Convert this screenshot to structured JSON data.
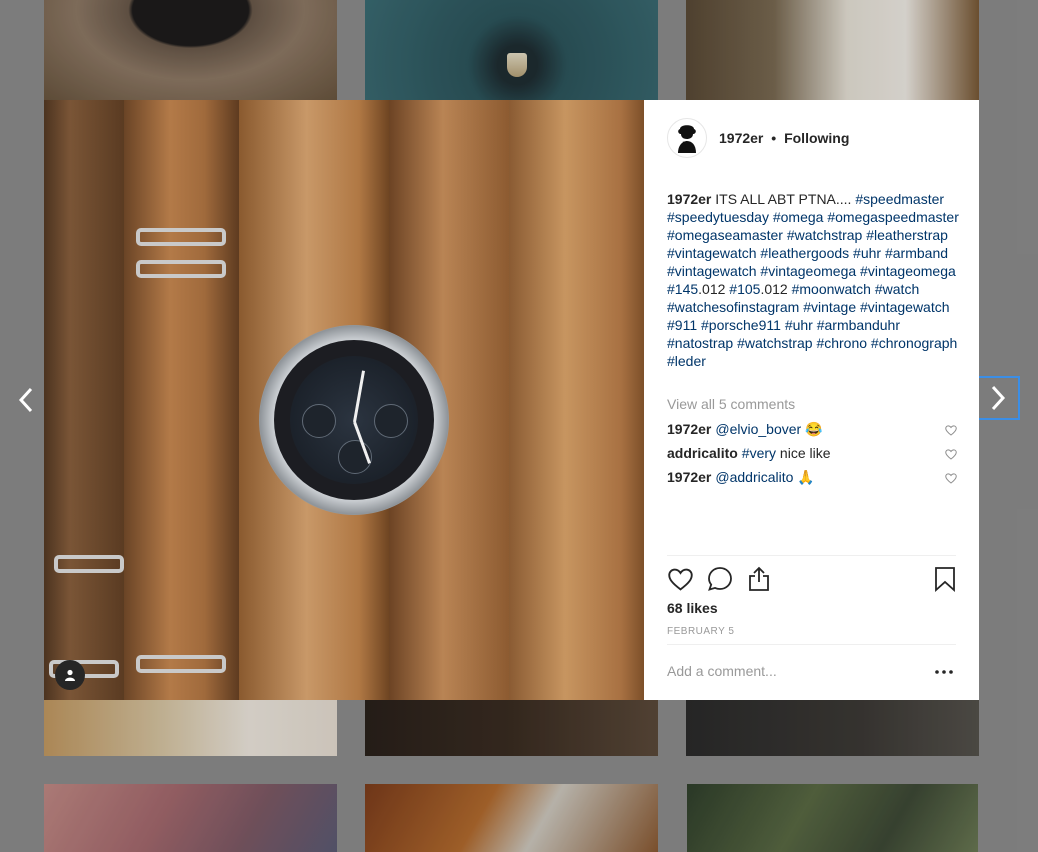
{
  "post": {
    "username": "1972er",
    "separator": "•",
    "follow_status": "Following",
    "caption": {
      "user": "1972er",
      "segments": [
        {
          "text": " ITS ALL ABT PTNA.... ",
          "tag": false
        },
        {
          "text": "#speedmaster",
          "tag": true
        },
        {
          "text": " ",
          "tag": false
        },
        {
          "text": "#speedytuesday",
          "tag": true
        },
        {
          "text": " ",
          "tag": false
        },
        {
          "text": "#omega",
          "tag": true
        },
        {
          "text": " ",
          "tag": false
        },
        {
          "text": "#omegaspeedmaster",
          "tag": true
        },
        {
          "text": " ",
          "tag": false
        },
        {
          "text": "#omegaseamaster",
          "tag": true
        },
        {
          "text": " ",
          "tag": false
        },
        {
          "text": "#watchstrap",
          "tag": true
        },
        {
          "text": " ",
          "tag": false
        },
        {
          "text": "#leatherstrap",
          "tag": true
        },
        {
          "text": " ",
          "tag": false
        },
        {
          "text": "#vintagewatch",
          "tag": true
        },
        {
          "text": " ",
          "tag": false
        },
        {
          "text": "#leathergoods",
          "tag": true
        },
        {
          "text": " ",
          "tag": false
        },
        {
          "text": "#uhr",
          "tag": true
        },
        {
          "text": " ",
          "tag": false
        },
        {
          "text": "#armband",
          "tag": true
        },
        {
          "text": " ",
          "tag": false
        },
        {
          "text": "#vintagewatch",
          "tag": true
        },
        {
          "text": " ",
          "tag": false
        },
        {
          "text": "#vintageomega",
          "tag": true
        },
        {
          "text": " ",
          "tag": false
        },
        {
          "text": "#vintageomega",
          "tag": true
        },
        {
          "text": " ",
          "tag": false
        },
        {
          "text": "#145",
          "tag": true
        },
        {
          "text": ".012 ",
          "tag": false
        },
        {
          "text": "#105",
          "tag": true
        },
        {
          "text": ".012 ",
          "tag": false
        },
        {
          "text": "#moonwatch",
          "tag": true
        },
        {
          "text": " ",
          "tag": false
        },
        {
          "text": "#watch",
          "tag": true
        },
        {
          "text": " ",
          "tag": false
        },
        {
          "text": "#watchesofinstagram",
          "tag": true
        },
        {
          "text": " ",
          "tag": false
        },
        {
          "text": "#vintage",
          "tag": true
        },
        {
          "text": " ",
          "tag": false
        },
        {
          "text": "#vintagewatch",
          "tag": true
        },
        {
          "text": " ",
          "tag": false
        },
        {
          "text": "#911",
          "tag": true
        },
        {
          "text": " ",
          "tag": false
        },
        {
          "text": "#porsche911",
          "tag": true
        },
        {
          "text": " ",
          "tag": false
        },
        {
          "text": "#uhr",
          "tag": true
        },
        {
          "text": " ",
          "tag": false
        },
        {
          "text": "#armbanduhr",
          "tag": true
        },
        {
          "text": " ",
          "tag": false
        },
        {
          "text": "#natostrap",
          "tag": true
        },
        {
          "text": " ",
          "tag": false
        },
        {
          "text": "#watchstrap",
          "tag": true
        },
        {
          "text": " ",
          "tag": false
        },
        {
          "text": "#chrono",
          "tag": true
        },
        {
          "text": " ",
          "tag": false
        },
        {
          "text": "#chronograph",
          "tag": true
        },
        {
          "text": " ",
          "tag": false
        },
        {
          "text": "#leder",
          "tag": true
        }
      ]
    },
    "view_all_comments": "View all 5 comments",
    "comments": [
      {
        "user": "1972er",
        "mention": "@elvio_bover",
        "text": " 😂"
      },
      {
        "user": "addricalito",
        "mention": "#very",
        "text": " nice like"
      },
      {
        "user": "1972er",
        "mention": "@addricalito",
        "text": " 🙏"
      }
    ],
    "likes": "68 likes",
    "date": "FEBRUARY 5",
    "add_comment_placeholder": "Add a comment..."
  },
  "icons": {
    "prev": "chevron-left-icon",
    "next": "chevron-right-icon",
    "like": "heart-icon",
    "comment": "comment-bubble-icon",
    "share": "share-icon",
    "save": "bookmark-icon",
    "more": "more-dots-icon",
    "photo_owner": "user-silhouette-icon"
  },
  "colors": {
    "hashtag": "#003569",
    "text": "#262626",
    "muted": "#999999",
    "focus_ring": "#3b8ee6"
  }
}
